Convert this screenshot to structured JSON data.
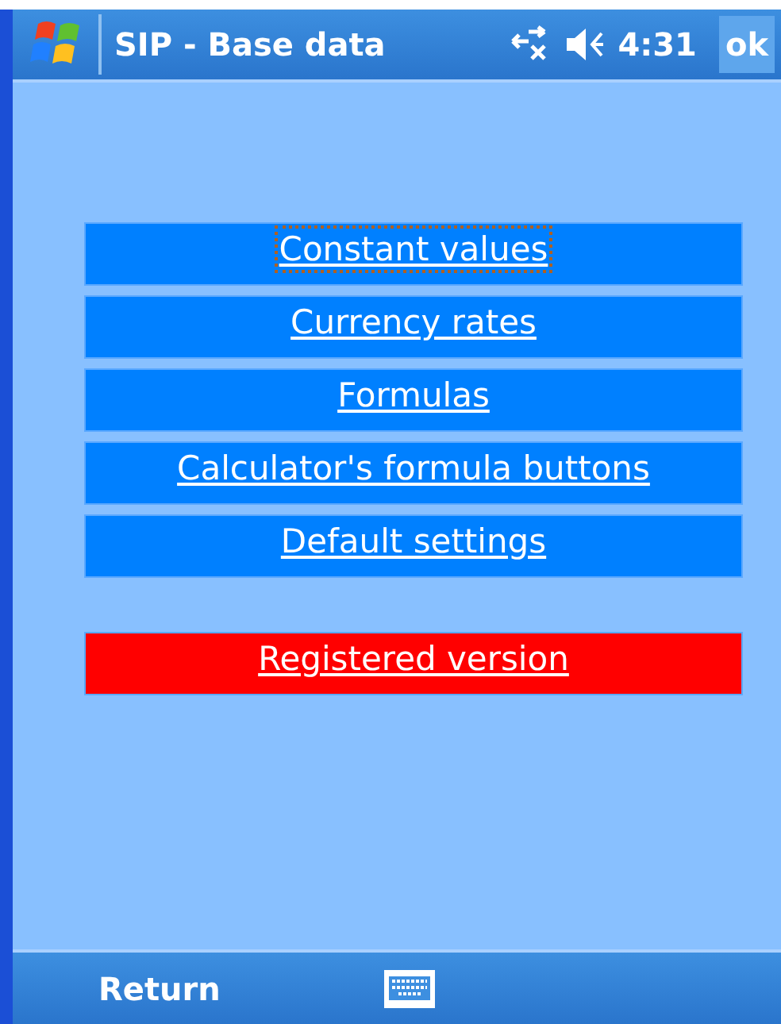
{
  "title_bar": {
    "title": "SIP - Base data",
    "time": "4:31",
    "ok_button": "ok"
  },
  "menu": [
    {
      "label": "Constant values",
      "color": "#0080ff",
      "focused": true
    },
    {
      "label": "Currency rates",
      "color": "#0080ff",
      "focused": false
    },
    {
      "label": "Formulas",
      "color": "#0080ff",
      "focused": false
    },
    {
      "label": "Calculator's formula buttons",
      "color": "#0080ff",
      "focused": false
    },
    {
      "label": "Default settings",
      "color": "#0080ff",
      "focused": false
    },
    {
      "label": "Registered version",
      "color": "#ff0000",
      "focused": false
    }
  ],
  "bottom_bar": {
    "left_soft_key": "Return"
  }
}
